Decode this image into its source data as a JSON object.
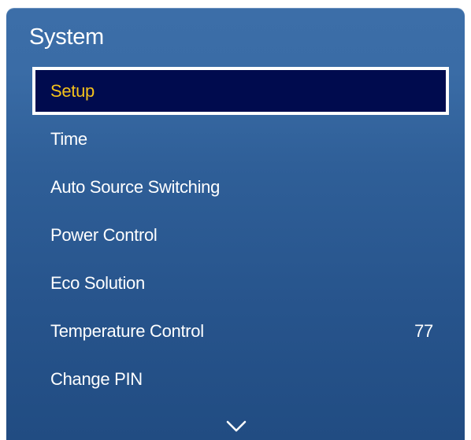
{
  "panel": {
    "title": "System"
  },
  "menu": {
    "items": [
      {
        "label": "Setup",
        "value": "",
        "selected": true
      },
      {
        "label": "Time",
        "value": ""
      },
      {
        "label": "Auto Source Switching",
        "value": ""
      },
      {
        "label": "Power Control",
        "value": ""
      },
      {
        "label": "Eco Solution",
        "value": ""
      },
      {
        "label": "Temperature Control",
        "value": "77"
      },
      {
        "label": "Change PIN",
        "value": ""
      }
    ]
  },
  "icons": {
    "scroll_down": "chevron-down-icon"
  },
  "colors": {
    "panel_top": "#3c6ea8",
    "panel_bottom": "#214c82",
    "selected_bg": "#000b4e",
    "selected_text": "#f4c21b",
    "text": "#ffffff"
  }
}
